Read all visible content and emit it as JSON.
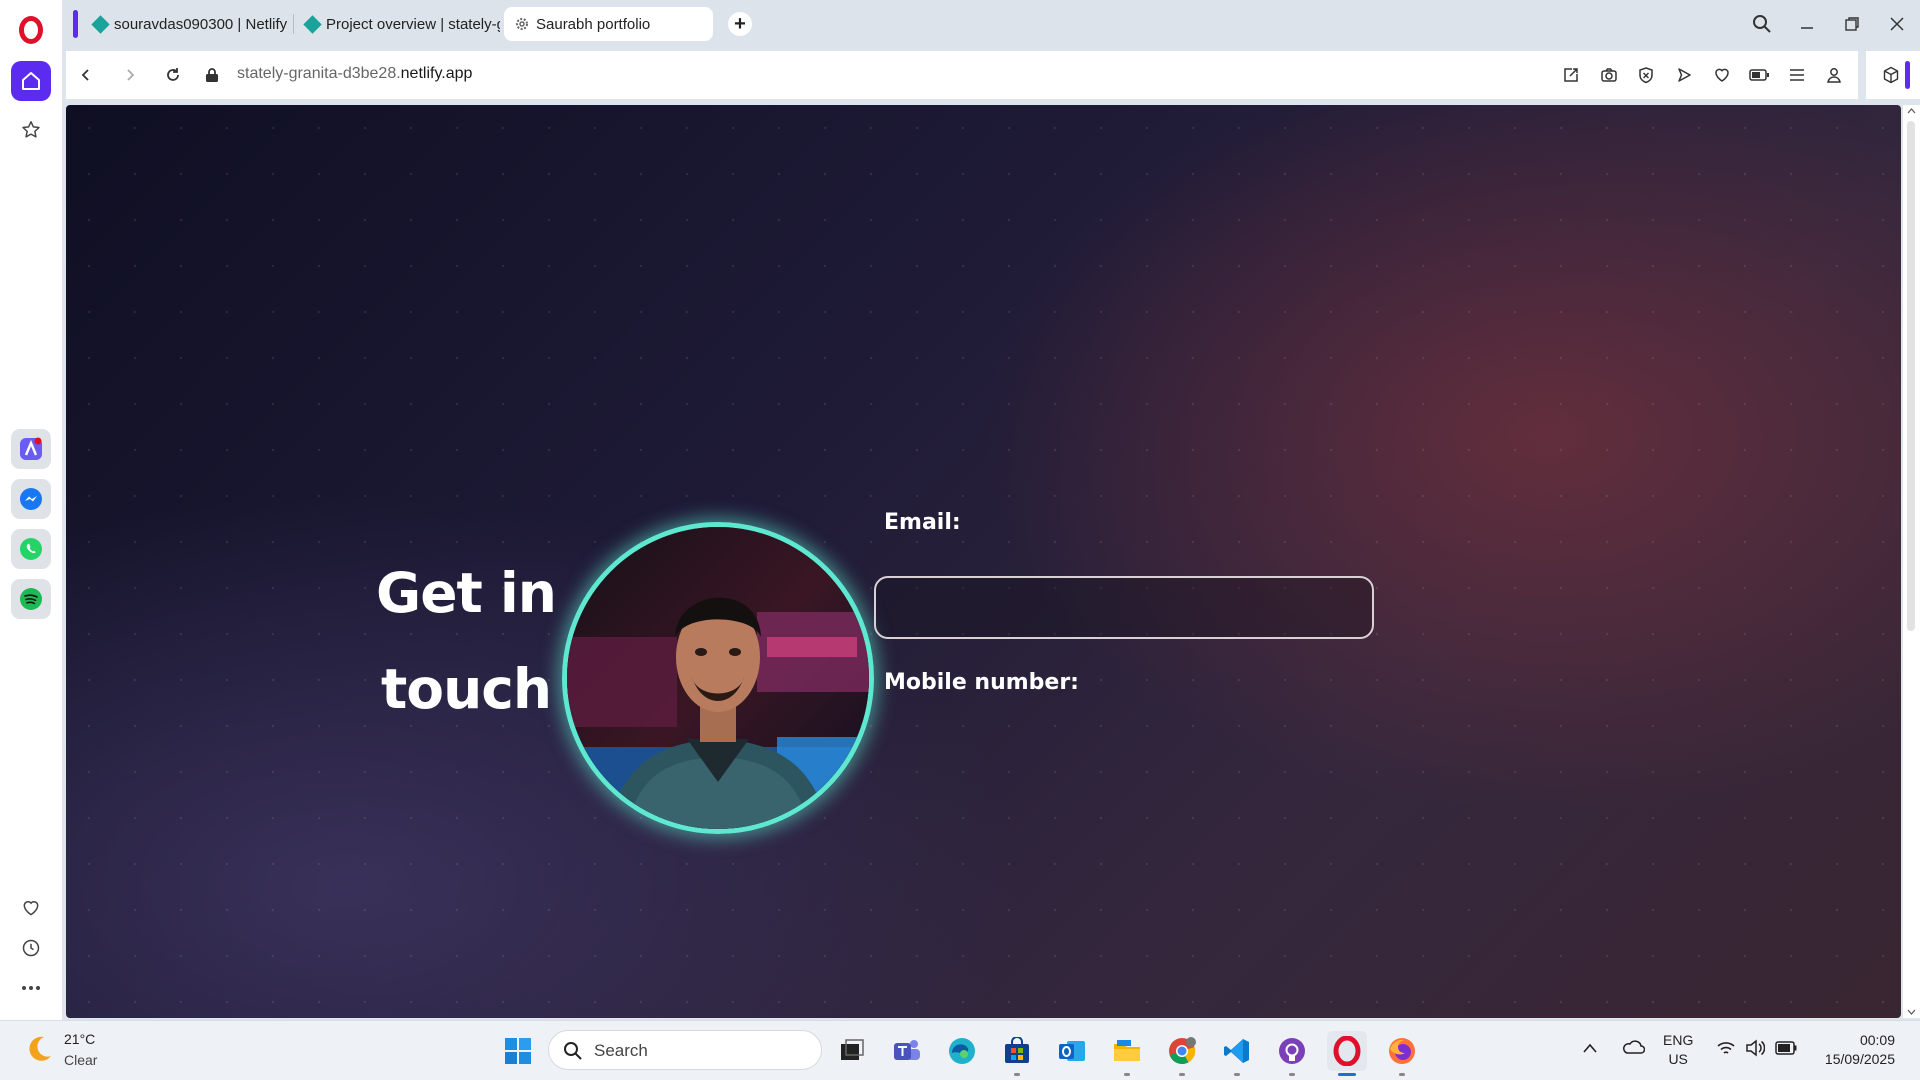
{
  "browser": {
    "tabs": [
      {
        "title": "souravdas090300 | Netlify",
        "active": false
      },
      {
        "title": "Project overview | stately-g",
        "active": false
      },
      {
        "title": "Saurabh portfolio",
        "active": true
      }
    ],
    "new_tab_label": "+",
    "address": {
      "url_prefix": "stately-granita-d3be28.",
      "url_domain": "netlify.app"
    },
    "accent_color": "#5b2bf0"
  },
  "sidebar": {
    "items": [
      "home-icon",
      "star-icon",
      "aria-icon",
      "messenger-icon",
      "whatsapp-icon",
      "spotify-icon",
      "heart-icon",
      "history-icon",
      "more-icon"
    ]
  },
  "page": {
    "heading": "Get in touch",
    "email_label": "Email:",
    "email_value": "",
    "mobile_label": "Mobile number:",
    "avatar_ring_color": "#5ee8cf"
  },
  "taskbar": {
    "weather": {
      "temp": "21°C",
      "condition": "Clear"
    },
    "search_placeholder": "Search",
    "language": {
      "line1": "ENG",
      "line2": "US"
    },
    "clock": {
      "time": "00:09",
      "date": "15/09/2025"
    }
  }
}
